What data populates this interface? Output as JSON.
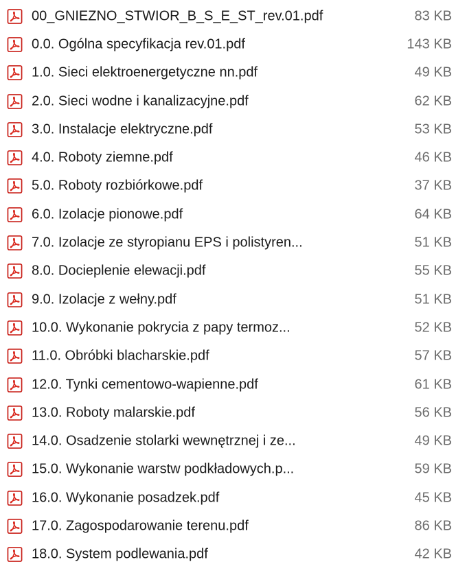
{
  "colors": {
    "icon_red": "#d9261c",
    "icon_border": "#c9211a",
    "name_text": "#1a1a1a",
    "size_text": "#6d6d6d",
    "background": "#ffffff"
  },
  "icon": "pdf-file-icon",
  "files": [
    {
      "name": "00_GNIEZNO_STWIOR_B_S_E_ST_rev.01.pdf",
      "size": "83 KB"
    },
    {
      "name": "0.0. Ogólna specyfikacja rev.01.pdf",
      "size": "143 KB"
    },
    {
      "name": "1.0. Sieci elektroenergetyczne nn.pdf",
      "size": "49 KB"
    },
    {
      "name": "2.0. Sieci wodne i kanalizacyjne.pdf",
      "size": "62 KB"
    },
    {
      "name": "3.0. Instalacje elektryczne.pdf",
      "size": "53 KB"
    },
    {
      "name": "4.0. Roboty ziemne.pdf",
      "size": "46 KB"
    },
    {
      "name": "5.0. Roboty rozbiórkowe.pdf",
      "size": "37 KB"
    },
    {
      "name": "6.0. Izolacje pionowe.pdf",
      "size": "64 KB"
    },
    {
      "name": "7.0. Izolacje ze styropianu EPS i polistyren...",
      "size": "51 KB"
    },
    {
      "name": "8.0. Docieplenie elewacji.pdf",
      "size": "55 KB"
    },
    {
      "name": "9.0. Izolacje z wełny.pdf",
      "size": "51 KB"
    },
    {
      "name": "10.0. Wykonanie pokrycia z papy termoz...",
      "size": "52 KB"
    },
    {
      "name": "11.0. Obróbki blacharskie.pdf",
      "size": "57 KB"
    },
    {
      "name": "12.0. Tynki cementowo-wapienne.pdf",
      "size": "61 KB"
    },
    {
      "name": "13.0. Roboty malarskie.pdf",
      "size": "56 KB"
    },
    {
      "name": "14.0. Osadzenie stolarki wewnętrznej i ze...",
      "size": "49 KB"
    },
    {
      "name": "15.0. Wykonanie warstw podkładowych.p...",
      "size": "59 KB"
    },
    {
      "name": "16.0. Wykonanie posadzek.pdf",
      "size": "45 KB"
    },
    {
      "name": "17.0. Zagospodarowanie terenu.pdf",
      "size": "86 KB"
    },
    {
      "name": "18.0. System podlewania.pdf",
      "size": "42 KB"
    }
  ]
}
